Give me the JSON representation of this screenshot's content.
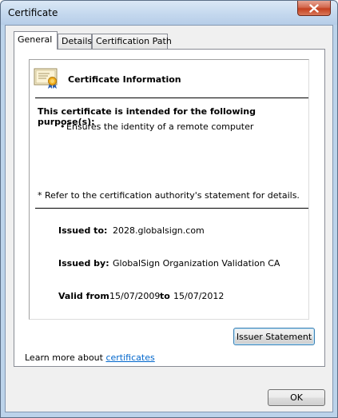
{
  "window": {
    "title": "Certificate",
    "close_icon": "close-icon"
  },
  "tabs": [
    {
      "label": "General",
      "active": true
    },
    {
      "label": "Details",
      "active": false
    },
    {
      "label": "Certification Path",
      "active": false
    }
  ],
  "general": {
    "icon": "certificate-icon",
    "heading": "Certificate Information",
    "purpose_heading": "This certificate is intended for the following purpose(s):",
    "purposes": [
      "Ensures the identity of a remote computer"
    ],
    "bullet": "•",
    "refer_note": "* Refer to the certification authority's statement for details.",
    "issued_to_label": "Issued to:",
    "issued_to_value": "2028.globalsign.com",
    "issued_by_label": "Issued by:",
    "issued_by_value": "GlobalSign Organization Validation CA",
    "valid_from_label": "Valid from",
    "valid_from_value": "15/07/2009",
    "valid_to_label": "to",
    "valid_to_value": "15/07/2012"
  },
  "issuer_statement_label": "Issuer Statement",
  "learn_more_text": "Learn more about",
  "learn_more_link": "certificates",
  "ok_label": "OK",
  "colors": {
    "link": "#0066cc",
    "frame": "#bcd3ea",
    "close_button": "#c4401f"
  }
}
